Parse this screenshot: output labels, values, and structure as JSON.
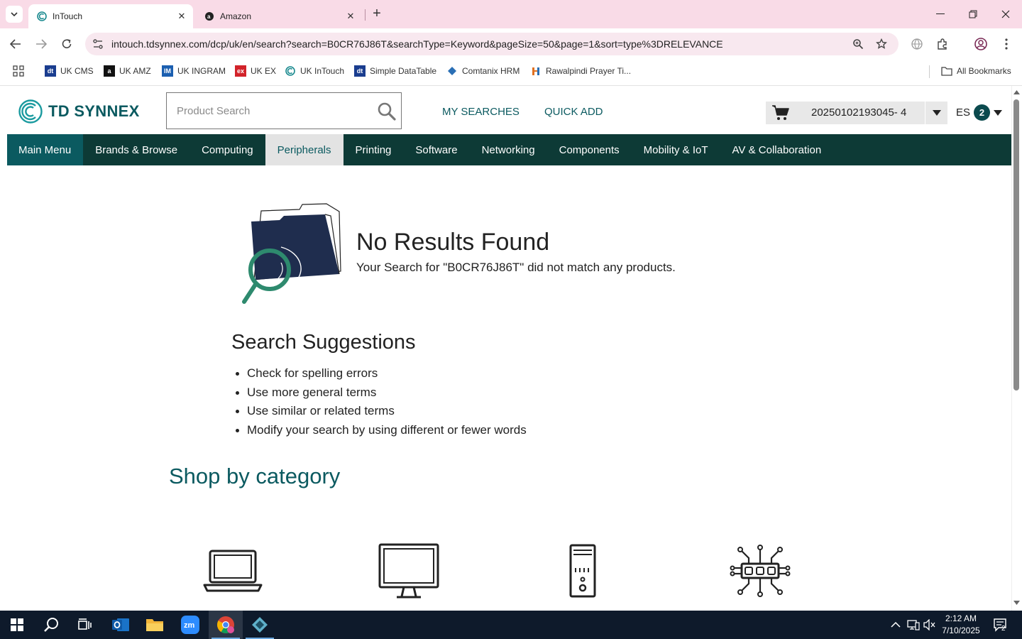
{
  "browser": {
    "tabs": [
      {
        "title": "InTouch",
        "active": true
      },
      {
        "title": "Amazon",
        "active": false
      }
    ],
    "url": "intouch.tdsynnex.com/dcp/uk/en/search?search=B0CR76J86T&searchType=Keyword&pageSize=50&page=1&sort=type%3DRELEVANCE",
    "bookmarks": [
      {
        "label": "UK CMS",
        "icon": "dt",
        "color": "#1a3d8f"
      },
      {
        "label": "UK AMZ",
        "icon": "a",
        "color": "#111111"
      },
      {
        "label": "UK INGRAM",
        "icon": "IM",
        "color": "#1b5fb0"
      },
      {
        "label": "UK EX",
        "icon": "ex",
        "color": "#d2232a"
      },
      {
        "label": "UK InTouch",
        "icon": "c",
        "color": "#0b7a80"
      },
      {
        "label": "Simple DataTable",
        "icon": "dt",
        "color": "#1a3d8f"
      },
      {
        "label": "Comtanix HRM",
        "icon": "c",
        "color": "#2a6fb5"
      },
      {
        "label": "Rawalpindi Prayer Ti...",
        "icon": "h",
        "color": "#e07020"
      }
    ],
    "all_bookmarks_label": "All Bookmarks"
  },
  "site": {
    "brand": "TD SYNNEX",
    "search_placeholder": "Product Search",
    "links": {
      "my_searches": "MY SEARCHES",
      "quick_add": "QUICK ADD"
    },
    "cart_label": "20250102193045- 4",
    "language": "ES",
    "badge_count": "2",
    "nav": [
      "Main Menu",
      "Brands & Browse",
      "Computing",
      "Peripherals",
      "Printing",
      "Software",
      "Networking",
      "Components",
      "Mobility & IoT",
      "AV & Collaboration"
    ],
    "selected_nav": "Peripherals",
    "accent": "#0b5a60",
    "nav_bg": "#0d3a36"
  },
  "main": {
    "no_results_title": "No Results Found",
    "no_results_sub": "Your Search for \"B0CR76J86T\" did not match any products.",
    "suggestions_title": "Search Suggestions",
    "suggestions": [
      "Check for spelling errors",
      "Use more general terms",
      "Use similar or related terms",
      "Modify your search by using different or fewer words"
    ],
    "shop_title": "Shop by category",
    "category_icons": [
      "laptop-icon",
      "monitor-icon",
      "desktop-tower-icon",
      "circuit-chip-icon"
    ]
  },
  "taskbar": {
    "time": "2:12 AM",
    "date": "7/10/2025",
    "notification_count": "2"
  }
}
